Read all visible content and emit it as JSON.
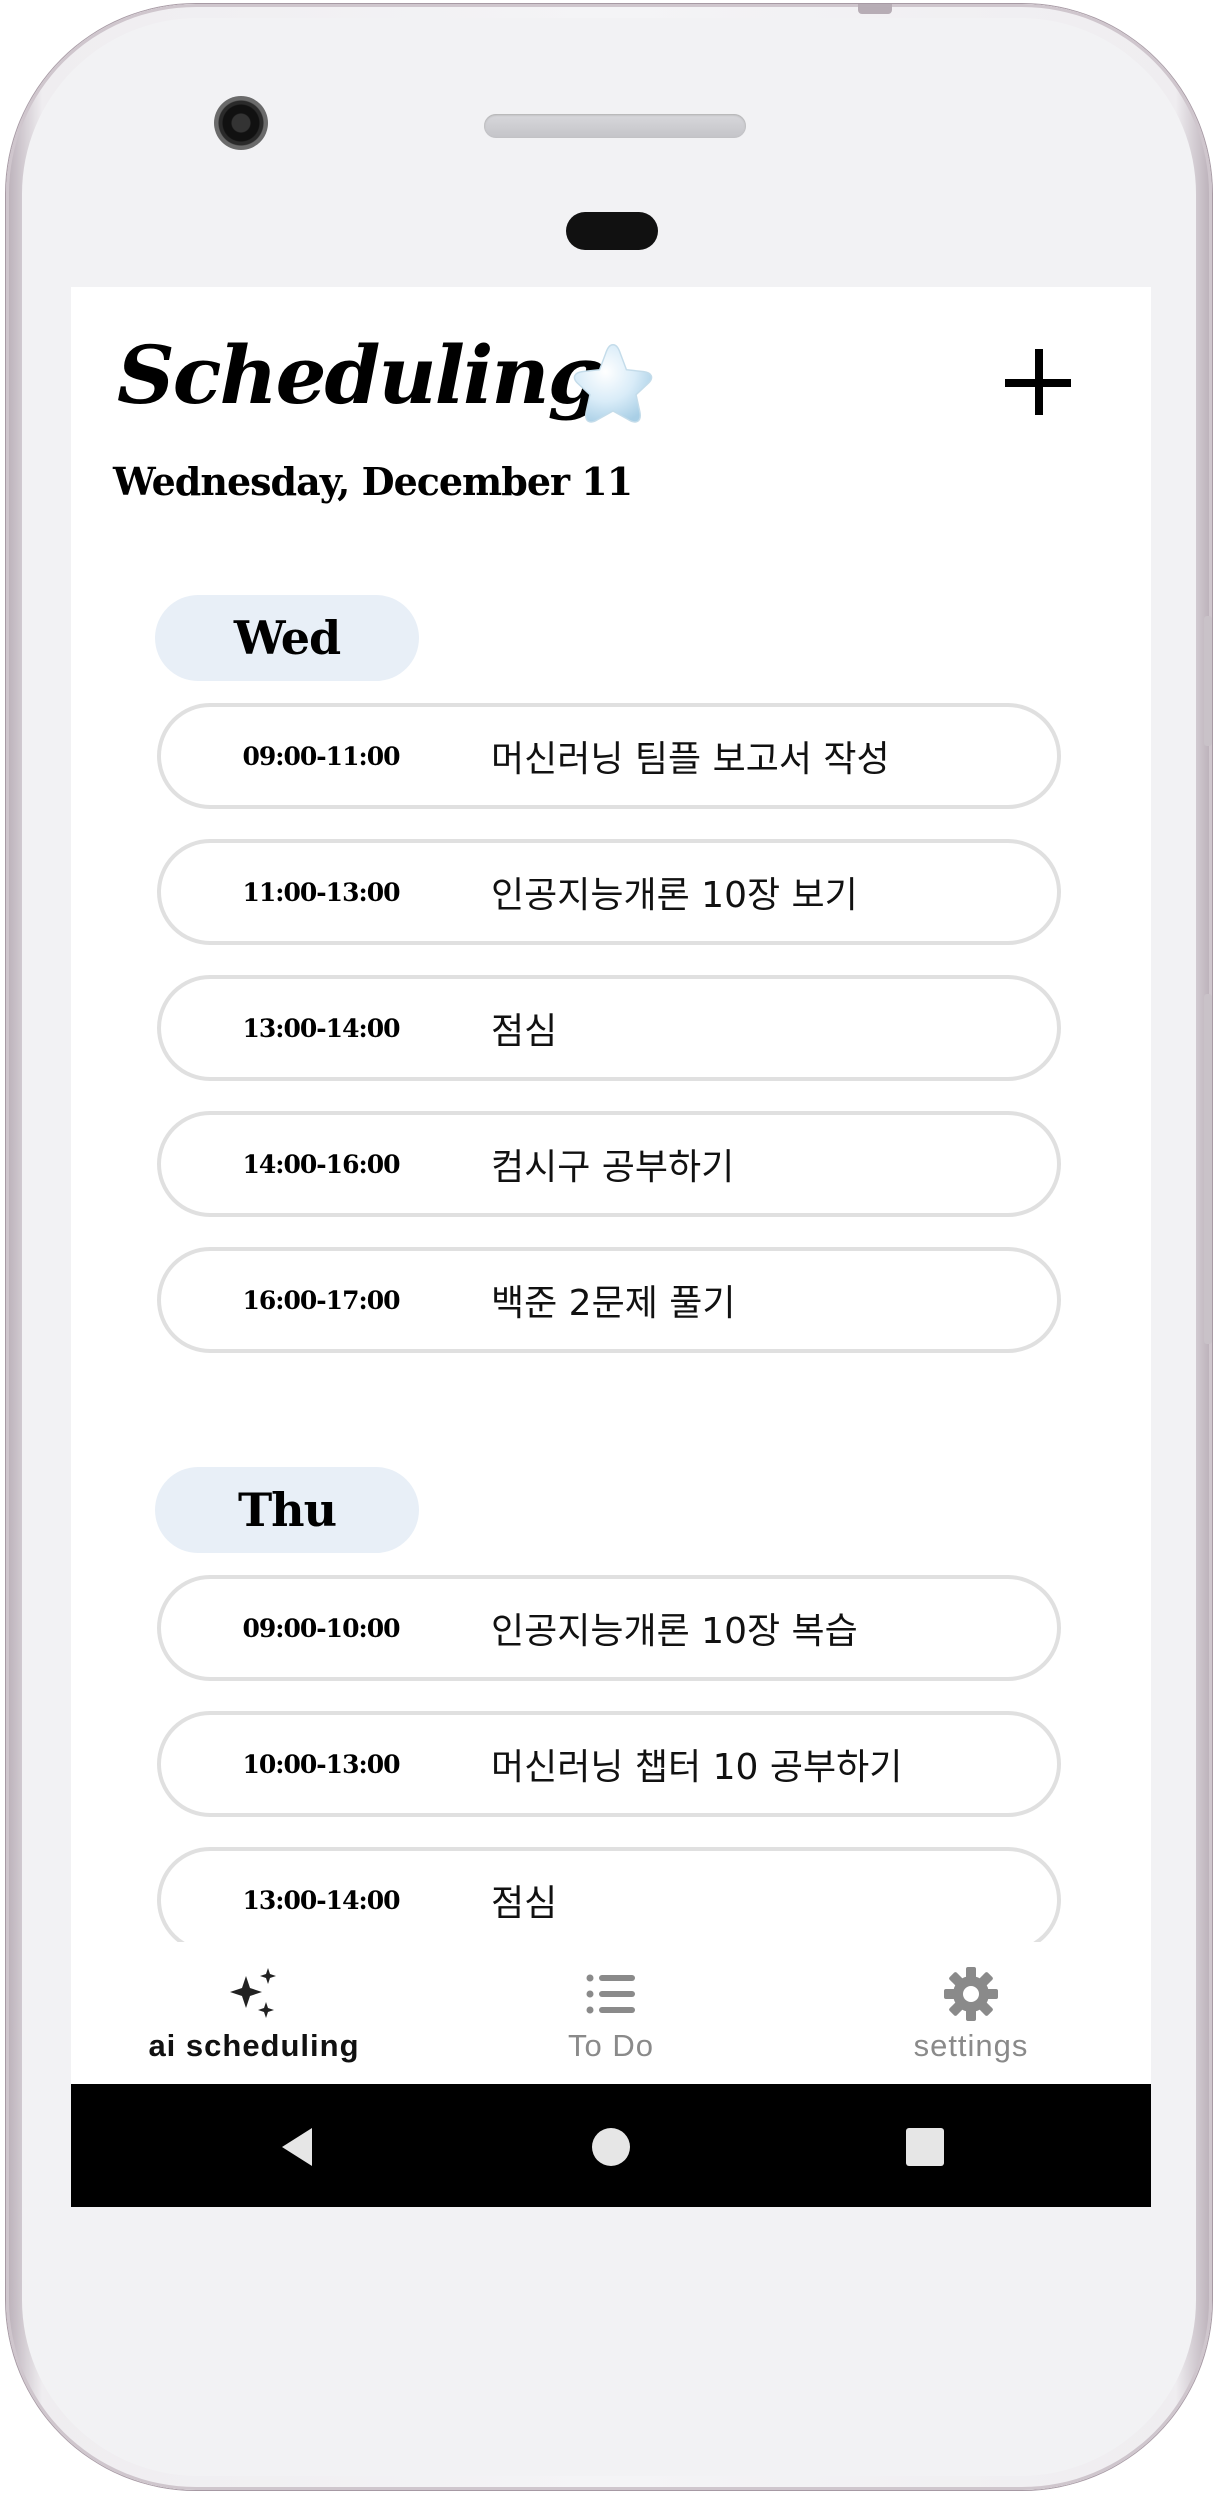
{
  "header": {
    "title": "Scheduling",
    "date": "Wednesday, December 11",
    "star_icon": "star-icon",
    "add_icon": "plus-icon"
  },
  "days": [
    {
      "label": "Wed",
      "slots": [
        {
          "time": "09:00-11:00",
          "task": "머신러닝 팀플 보고서 작성"
        },
        {
          "time": "11:00-13:00",
          "task": "인공지능개론 10장 보기"
        },
        {
          "time": "13:00-14:00",
          "task": "점심"
        },
        {
          "time": "14:00-16:00",
          "task": "컴시구 공부하기"
        },
        {
          "time": "16:00-17:00",
          "task": "백준 2문제 풀기"
        }
      ]
    },
    {
      "label": "Thu",
      "slots": [
        {
          "time": "09:00-10:00",
          "task": "인공지능개론 10장 복습"
        },
        {
          "time": "10:00-13:00",
          "task": "머신러닝 챕터 10 공부하기"
        },
        {
          "time": "13:00-14:00",
          "task": "점심"
        }
      ]
    }
  ],
  "bottom_nav": {
    "items": [
      {
        "label": "ai scheduling",
        "icon": "sparkles-icon",
        "active": true
      },
      {
        "label": "To Do",
        "icon": "list-icon",
        "active": false
      },
      {
        "label": "settings",
        "icon": "gear-icon",
        "active": false
      }
    ]
  },
  "colors": {
    "day_chip_bg": "#e8eff7",
    "slot_border": "#e0e0e0",
    "nav_active": "#111111",
    "nav_inactive": "#8a8a8a"
  }
}
